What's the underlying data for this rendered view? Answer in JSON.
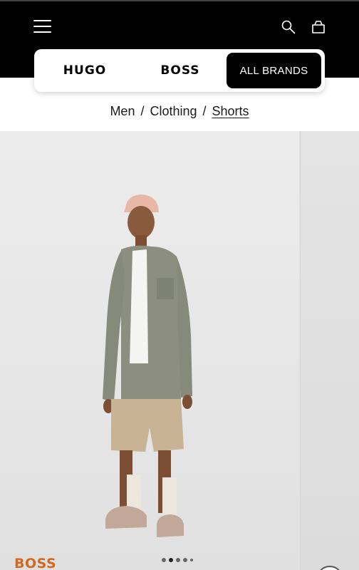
{
  "header": {
    "menu_icon": "hamburger-menu-icon",
    "search_icon": "search-icon",
    "bag_icon": "shopping-bag-icon",
    "background": "#000000"
  },
  "brand_switcher": {
    "tabs": [
      {
        "label": "HUGO",
        "selected": false
      },
      {
        "label": "BOSS",
        "selected": false
      },
      {
        "label": "ALL BRANDS",
        "selected": true
      }
    ]
  },
  "breadcrumb": {
    "items": [
      "Men",
      "Clothing",
      "Shorts"
    ],
    "separator": "/"
  },
  "product": {
    "brand": "BOSS",
    "brand_color": "#d2691e",
    "image_count": 5,
    "current_image": 2
  }
}
